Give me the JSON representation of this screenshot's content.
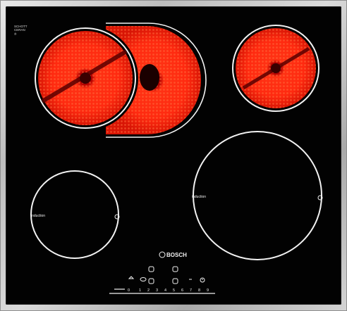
{
  "brand": {
    "glass_line1": "SCHOTT",
    "glass_line2": "CERAN",
    "glass_line3": "®",
    "logo_text": "BOSCH"
  },
  "zones": {
    "left_induction_label": "induction",
    "right_induction_label": "induction"
  },
  "controls": {
    "scale": [
      "0",
      "1",
      "2",
      "3",
      "4",
      "5",
      "6",
      "7",
      "8",
      "9"
    ],
    "icons": [
      "lock-icon",
      "dual-zone-icon",
      "timer-icon"
    ]
  },
  "colors": {
    "glass": "#020202",
    "frame": "#c9c9c9",
    "heat": "#ff2a10",
    "ring": "#f2f2f2"
  }
}
